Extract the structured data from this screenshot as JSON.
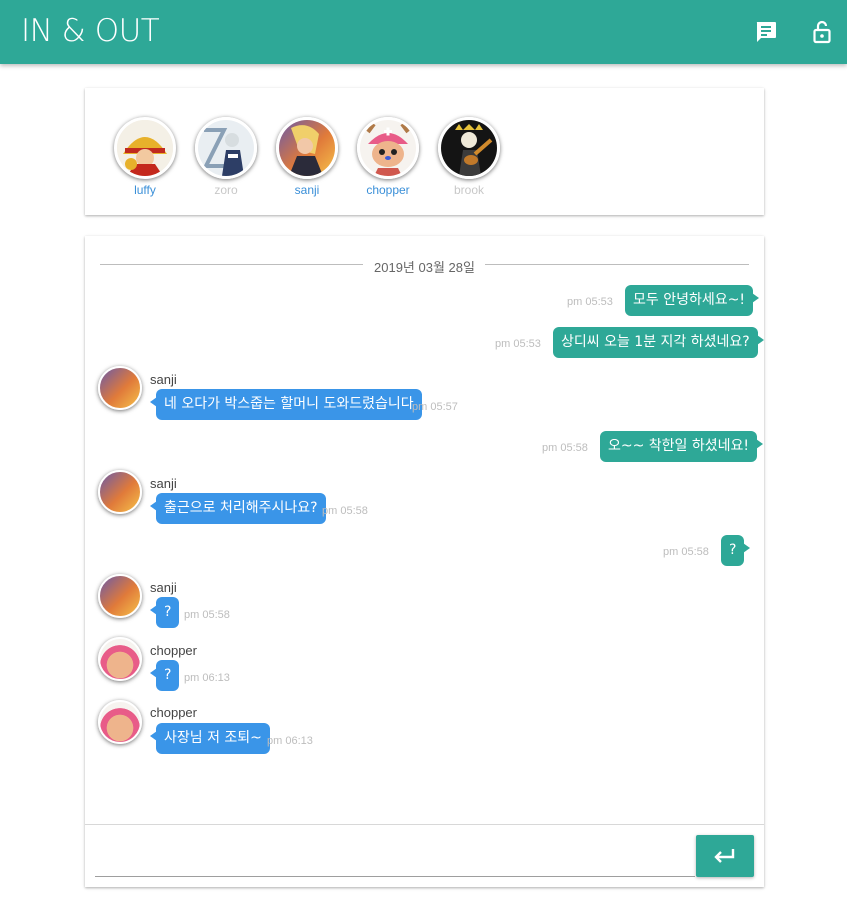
{
  "app": {
    "title": "IN & OUT"
  },
  "toolbar": {
    "chat_icon": "chat-bubble-icon",
    "logout_icon": "lock-icon"
  },
  "members": [
    {
      "name": "luffy",
      "status": "online"
    },
    {
      "name": "zoro",
      "status": "offline"
    },
    {
      "name": "sanji",
      "status": "online"
    },
    {
      "name": "chopper",
      "status": "online"
    },
    {
      "name": "brook",
      "status": "offline"
    }
  ],
  "chat": {
    "date": "2019년 03월 28일",
    "messages": [
      {
        "mine": true,
        "text": "모두 안녕하세요~!",
        "time": "pm 05:53"
      },
      {
        "mine": true,
        "text": "상디씨 오늘 1분 지각 하셨네요?",
        "time": "pm 05:53"
      },
      {
        "mine": false,
        "sender": "sanji",
        "text": "네 오다가 박스줍는 할머니 도와드렸습니다",
        "time": "pm 05:57"
      },
      {
        "mine": true,
        "text": "오~~ 착한일 하셨네요!",
        "time": "pm 05:58"
      },
      {
        "mine": false,
        "sender": "sanji",
        "text": "출근으로 처리해주시나요?",
        "time": "pm 05:58"
      },
      {
        "mine": true,
        "text": "?",
        "time": "pm 05:58"
      },
      {
        "mine": false,
        "sender": "sanji",
        "text": "?",
        "time": "pm 05:58"
      },
      {
        "mine": false,
        "sender": "chopper",
        "text": "?",
        "time": "pm 06:13"
      },
      {
        "mine": false,
        "sender": "chopper",
        "text": "사장님 저 조퇴~",
        "time": "pm 06:13"
      }
    ]
  },
  "input": {
    "value": "",
    "placeholder": "",
    "send_icon": "enter-arrow-icon"
  },
  "colors": {
    "primary": "#2ea897",
    "incoming": "#3a95e8"
  }
}
